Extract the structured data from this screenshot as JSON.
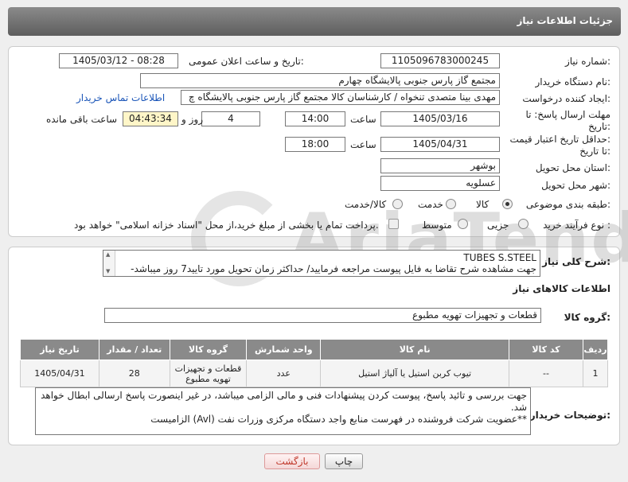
{
  "header": {
    "title": "جزئیات اطلاعات نیاز"
  },
  "form": {
    "need_number_label": "شماره نیاز:",
    "need_number": "1105096783000245",
    "announce_label": "تاریخ و ساعت اعلان عمومی:",
    "announce_value": "1405/03/12 - 08:28",
    "buyer_org_label": "نام دستگاه خریدار:",
    "buyer_org": "مجتمع گاز پارس جنوبی  پالایشگاه چهارم",
    "creator_label": "ایجاد کننده درخواست:",
    "creator": "مهدی بینا متصدی تنخواه / کارشناسان کالا مجتمع گاز پارس جنوبی  پالایشگاه چ",
    "contact_link": "اطلاعات تماس خریدار",
    "deadline_label_1": "مهلت ارسال پاسخ: تا",
    "deadline_label_2": "تاریخ:",
    "deadline_date": "1405/03/16",
    "time_label": "ساعت",
    "deadline_time": "14:00",
    "days_value": "4",
    "days_label": "روز و",
    "remaining_time": "04:43:34",
    "remaining_label": "ساعت باقی مانده",
    "validity_label_1": "حداقل تاریخ اعتبار قیمت:",
    "validity_label_2": "تا تاریخ:",
    "validity_date": "1405/04/31",
    "validity_time_label": "ساعت",
    "validity_time": "18:00",
    "province_label": "استان محل تحویل:",
    "province": "بوشهر",
    "city_label": "شهر محل تحویل:",
    "city": "عسلویه",
    "category_label": "طبقه بندی موضوعی:",
    "category_options": [
      "کالا",
      "خدمت",
      "کالا/خدمت"
    ],
    "category_selected": "کالا",
    "process_label": "نوع فرآیند خرید :",
    "process_options": [
      "جزیی",
      "متوسط"
    ],
    "payment_text": "پرداخت تمام یا بخشی از مبلغ خرید،از محل \"اسناد خزانه اسلامی\" خواهد بود."
  },
  "description": {
    "label": "شرح کلی نیاز:",
    "line1": "TUBES S.STEEL",
    "line2": "جهت مشاهده شرح تقاضا به فایل پیوست مراجعه فرمایید/ حداکثر زمان تحویل مورد تایید7 روز میباشد-"
  },
  "items_section": {
    "title": "اطلاعات کالاهای نیاز",
    "group_label": "گروه کالا:",
    "group_value": "قطعات و تجهیزات تهویه مطبوع",
    "columns": [
      "ردیف",
      "کد کالا",
      "نام کالا",
      "واحد شمارش",
      "گروه کالا",
      "تعداد / مقدار",
      "تاریخ نیاز"
    ],
    "rows": [
      {
        "index": "1",
        "code": "--",
        "name": "تیوب کربن استیل یا آلیاژ استیل",
        "unit": "عدد",
        "group": "قطعات و تجهیزات تهویه مطبوع",
        "qty": "28",
        "date": "1405/04/31"
      }
    ]
  },
  "buyer_notes": {
    "label": "توضیحات خریدار:",
    "line1": "جهت بررسی و تائید پاسخ، پیوست کردن پیشنهادات فنی و مالی الزامی میباشد، در غیر اینصورت پاسخ ارسالی ابطال خواهد شد.",
    "line2": "**عضویت شرکت فروشنده در فهرست منابع واجد دستگاه مرکزی وزرات نفت (Avl) الزامیست"
  },
  "buttons": {
    "print": "چاپ",
    "back": "بازگشت"
  },
  "watermark": {
    "text": "AriaTender.net"
  }
}
